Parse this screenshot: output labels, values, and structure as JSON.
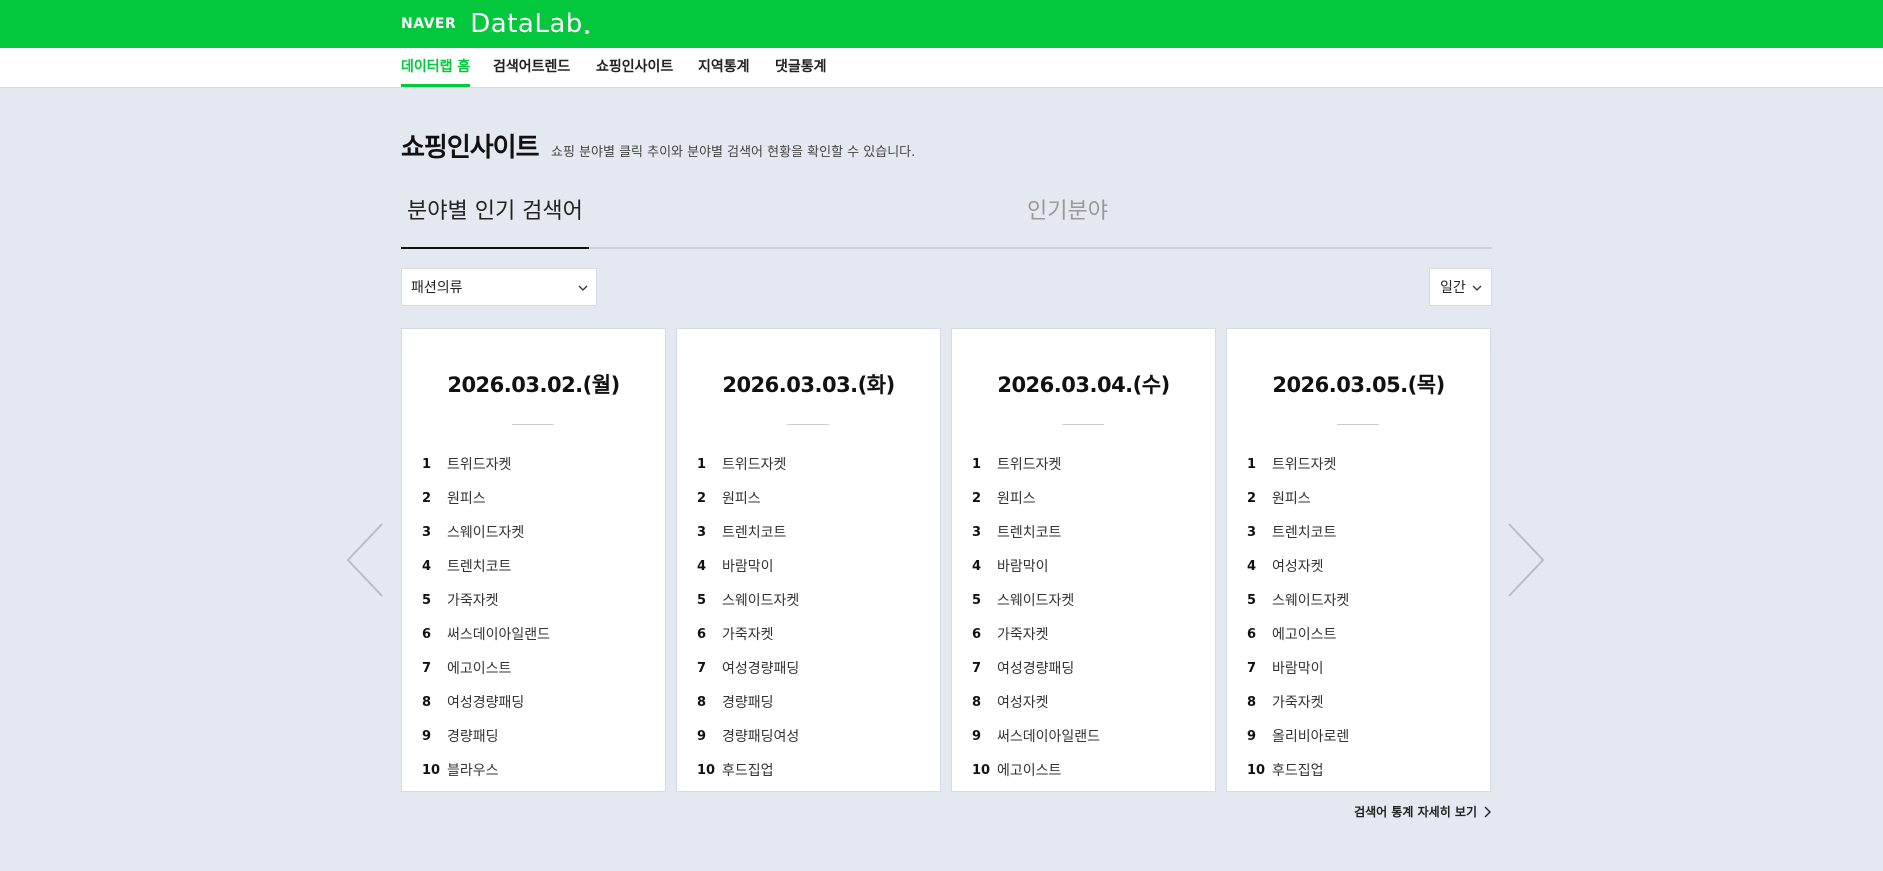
{
  "header": {
    "brand_naver": "NAVER",
    "brand_datalab": "DataLab"
  },
  "nav": {
    "items": [
      {
        "label": "데이터랩 홈",
        "active": true
      },
      {
        "label": "검색어트렌드",
        "active": false
      },
      {
        "label": "쇼핑인사이트",
        "active": false
      },
      {
        "label": "지역통계",
        "active": false
      },
      {
        "label": "댓글통계",
        "active": false
      }
    ]
  },
  "page": {
    "title": "쇼핑인사이트",
    "description": "쇼핑 분야별 클릭 추이와 분야별 검색어 현황을 확인할 수 있습니다."
  },
  "tabs": [
    {
      "label": "분야별 인기 검색어",
      "active": true
    },
    {
      "label": "인기분야",
      "active": false
    }
  ],
  "filters": {
    "category": "패션의류",
    "period": "일간"
  },
  "cards": [
    {
      "date": "2026.03.02.(월)",
      "rankings": [
        {
          "rank": "1",
          "keyword": "트위드자켓"
        },
        {
          "rank": "2",
          "keyword": "원피스"
        },
        {
          "rank": "3",
          "keyword": "스웨이드자켓"
        },
        {
          "rank": "4",
          "keyword": "트렌치코트"
        },
        {
          "rank": "5",
          "keyword": "가죽자켓"
        },
        {
          "rank": "6",
          "keyword": "써스데이아일랜드"
        },
        {
          "rank": "7",
          "keyword": "에고이스트"
        },
        {
          "rank": "8",
          "keyword": "여성경량패딩"
        },
        {
          "rank": "9",
          "keyword": "경량패딩"
        },
        {
          "rank": "10",
          "keyword": "블라우스"
        }
      ]
    },
    {
      "date": "2026.03.03.(화)",
      "rankings": [
        {
          "rank": "1",
          "keyword": "트위드자켓"
        },
        {
          "rank": "2",
          "keyword": "원피스"
        },
        {
          "rank": "3",
          "keyword": "트렌치코트"
        },
        {
          "rank": "4",
          "keyword": "바람막이"
        },
        {
          "rank": "5",
          "keyword": "스웨이드자켓"
        },
        {
          "rank": "6",
          "keyword": "가죽자켓"
        },
        {
          "rank": "7",
          "keyword": "여성경량패딩"
        },
        {
          "rank": "8",
          "keyword": "경량패딩"
        },
        {
          "rank": "9",
          "keyword": "경량패딩여성"
        },
        {
          "rank": "10",
          "keyword": "후드집업"
        }
      ]
    },
    {
      "date": "2026.03.04.(수)",
      "rankings": [
        {
          "rank": "1",
          "keyword": "트위드자켓"
        },
        {
          "rank": "2",
          "keyword": "원피스"
        },
        {
          "rank": "3",
          "keyword": "트렌치코트"
        },
        {
          "rank": "4",
          "keyword": "바람막이"
        },
        {
          "rank": "5",
          "keyword": "스웨이드자켓"
        },
        {
          "rank": "6",
          "keyword": "가죽자켓"
        },
        {
          "rank": "7",
          "keyword": "여성경량패딩"
        },
        {
          "rank": "8",
          "keyword": "여성자켓"
        },
        {
          "rank": "9",
          "keyword": "써스데이아일랜드"
        },
        {
          "rank": "10",
          "keyword": "에고이스트"
        }
      ]
    },
    {
      "date": "2026.03.05.(목)",
      "rankings": [
        {
          "rank": "1",
          "keyword": "트위드자켓"
        },
        {
          "rank": "2",
          "keyword": "원피스"
        },
        {
          "rank": "3",
          "keyword": "트렌치코트"
        },
        {
          "rank": "4",
          "keyword": "여성자켓"
        },
        {
          "rank": "5",
          "keyword": "스웨이드자켓"
        },
        {
          "rank": "6",
          "keyword": "에고이스트"
        },
        {
          "rank": "7",
          "keyword": "바람막이"
        },
        {
          "rank": "8",
          "keyword": "가죽자켓"
        },
        {
          "rank": "9",
          "keyword": "올리비아로렌"
        },
        {
          "rank": "10",
          "keyword": "후드집업"
        }
      ]
    }
  ],
  "more_link": "검색어 통계 자세히 보기",
  "colors": {
    "brand_green": "#03c73c",
    "page_background": "#e4e8f0"
  },
  "icons": {
    "dropdown": "chevron-down-icon",
    "prev": "chevron-left-icon",
    "next": "chevron-right-icon",
    "more": "chevron-right-icon"
  }
}
